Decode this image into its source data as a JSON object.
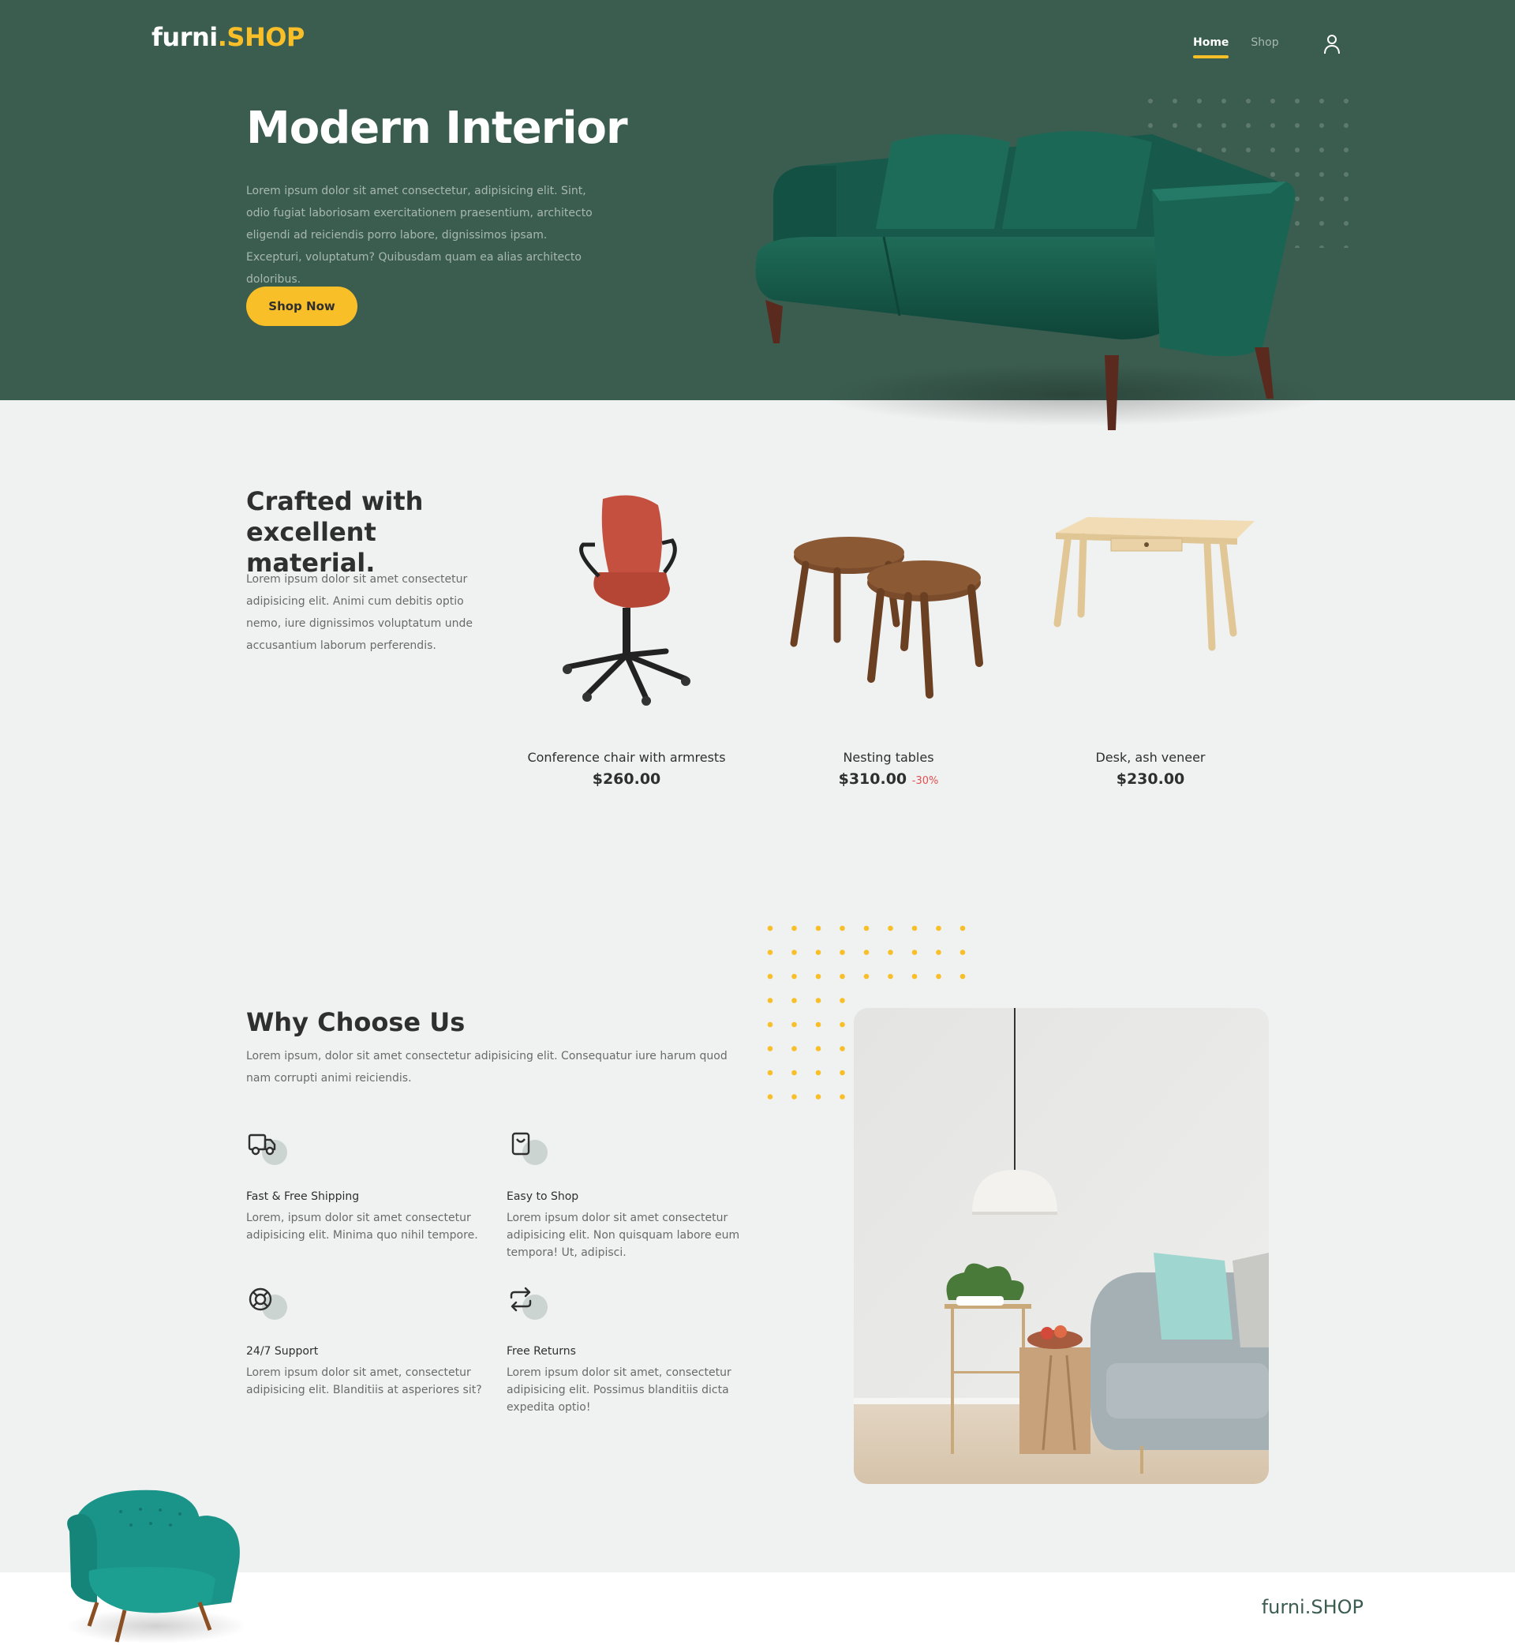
{
  "header": {
    "logo_main": "furni",
    "logo_dot": ".",
    "logo_shop": "SHOP",
    "nav": [
      {
        "label": "Home",
        "active": true
      },
      {
        "label": "Shop",
        "active": false
      }
    ],
    "user_icon": "user-icon"
  },
  "hero": {
    "title": "Modern Interior",
    "text": "Lorem ipsum dolor sit amet consectetur, adipisicing elit. Sint, odio fugiat laboriosam exercitationem praesentium, architecto eligendi ad reiciendis porro labore, dignissimos ipsam. Excepturi, voluptatum? Quibusdam quam ea alias architecto doloribus.",
    "button": "Shop Now"
  },
  "products": {
    "title": "Crafted with excellent material.",
    "text": "Lorem ipsum dolor sit amet consectetur adipisicing elit. Animi cum debitis optio nemo, iure dignissimos voluptatum unde accusantium laborum perferendis.",
    "items": [
      {
        "name": "Conference chair with armrests",
        "price": "$260.00",
        "discount": ""
      },
      {
        "name": "Nesting tables",
        "price": "$310.00",
        "discount": "-30%"
      },
      {
        "name": "Desk, ash veneer",
        "price": "$230.00",
        "discount": ""
      }
    ]
  },
  "why": {
    "title": "Why Choose Us",
    "text": "Lorem ipsum, dolor sit amet consectetur adipisicing elit. Consequatur iure harum quod nam corrupti animi reiciendis.",
    "features": [
      {
        "icon": "truck-icon",
        "title": "Fast & Free Shipping",
        "text": "Lorem, ipsum dolor sit amet consectetur adipisicing elit. Minima quo nihil tempore."
      },
      {
        "icon": "shopping-bag-icon",
        "title": "Easy to Shop",
        "text": "Lorem ipsum dolor sit amet consectetur adipisicing elit. Non quisquam labore eum tempora! Ut, adipisci."
      },
      {
        "icon": "lifebuoy-icon",
        "title": "24/7 Support",
        "text": "Lorem ipsum dolor sit amet, consectetur adipisicing elit. Blanditiis at asperiores sit?"
      },
      {
        "icon": "repeat-icon",
        "title": "Free Returns",
        "text": "Lorem ipsum dolor sit amet, consectetur adipisicing elit. Possimus blanditiis dicta expedita optio!"
      }
    ]
  },
  "footer": {
    "logo": "furni.SHOP"
  },
  "colors": {
    "primary": "#3b5d50",
    "accent": "#f9bf29",
    "background": "#eff2f1",
    "text": "#2f2f2f",
    "discount": "#e05050"
  }
}
